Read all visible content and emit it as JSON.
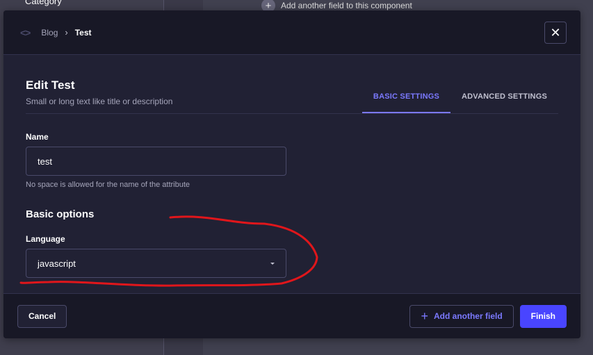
{
  "background": {
    "sidebar_item": "Category",
    "add_field_label": "Add another field to this component"
  },
  "header": {
    "breadcrumb": [
      "Blog",
      "Test"
    ],
    "close_icon": "close-icon"
  },
  "title": "Edit Test",
  "subtitle": "Small or long text like title or description",
  "tabs": [
    {
      "label": "BASIC SETTINGS",
      "active": true
    },
    {
      "label": "ADVANCED SETTINGS",
      "active": false
    }
  ],
  "name_field": {
    "label": "Name",
    "value": "test",
    "hint": "No space is allowed for the name of the attribute"
  },
  "basic_options": {
    "heading": "Basic options",
    "language_label": "Language",
    "language_value": "javascript"
  },
  "footer": {
    "cancel": "Cancel",
    "add_another": "Add another field",
    "finish": "Finish"
  },
  "colors": {
    "accent": "#4945ff",
    "tab_active": "#7b79ff",
    "annotation": "#e0161b"
  }
}
